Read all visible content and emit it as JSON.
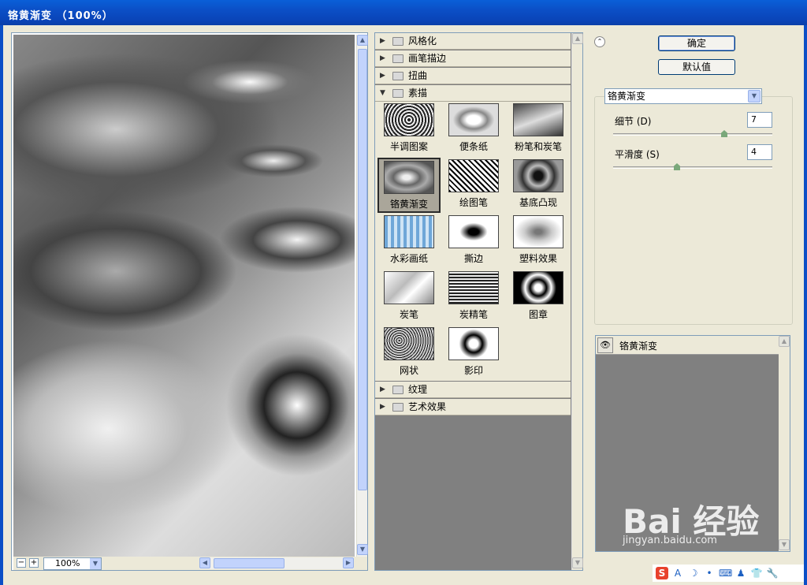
{
  "window": {
    "title": "铬黄渐变 （100%）"
  },
  "preview": {
    "zoom_value": "100%",
    "zoom_out": "−",
    "zoom_in": "+"
  },
  "categories": [
    {
      "label": "风格化",
      "expanded": false
    },
    {
      "label": "画笔描边",
      "expanded": false
    },
    {
      "label": "扭曲",
      "expanded": false
    },
    {
      "label": "素描",
      "expanded": true
    },
    {
      "label": "纹理",
      "expanded": false
    },
    {
      "label": "艺术效果",
      "expanded": false
    }
  ],
  "sketch_filters": [
    "半调图案",
    "便条纸",
    "粉笔和炭笔",
    "铬黄渐变",
    "绘图笔",
    "基底凸现",
    "水彩画纸",
    "撕边",
    "塑料效果",
    "炭笔",
    "炭精笔",
    "图章",
    "网状",
    "影印"
  ],
  "selected_filter": "铬黄渐变",
  "buttons": {
    "ok": "确定",
    "default": "默认值"
  },
  "settings": {
    "filter_select": "铬黄渐变",
    "detail_label": "细节 (D)",
    "detail_value": "7",
    "detail_level": 0.7,
    "smoothness_label": "平滑度 (S)",
    "smoothness_value": "4",
    "smoothness_level": 0.4
  },
  "layers": [
    {
      "name": "铬黄渐变",
      "visible": true
    }
  ],
  "watermark": {
    "text": "Bai 经验",
    "url": "jingyan.baidu.com"
  },
  "tray_icons": [
    "S",
    "A",
    "☽",
    "•",
    "⌨",
    "♟",
    "👕",
    "🔧"
  ]
}
